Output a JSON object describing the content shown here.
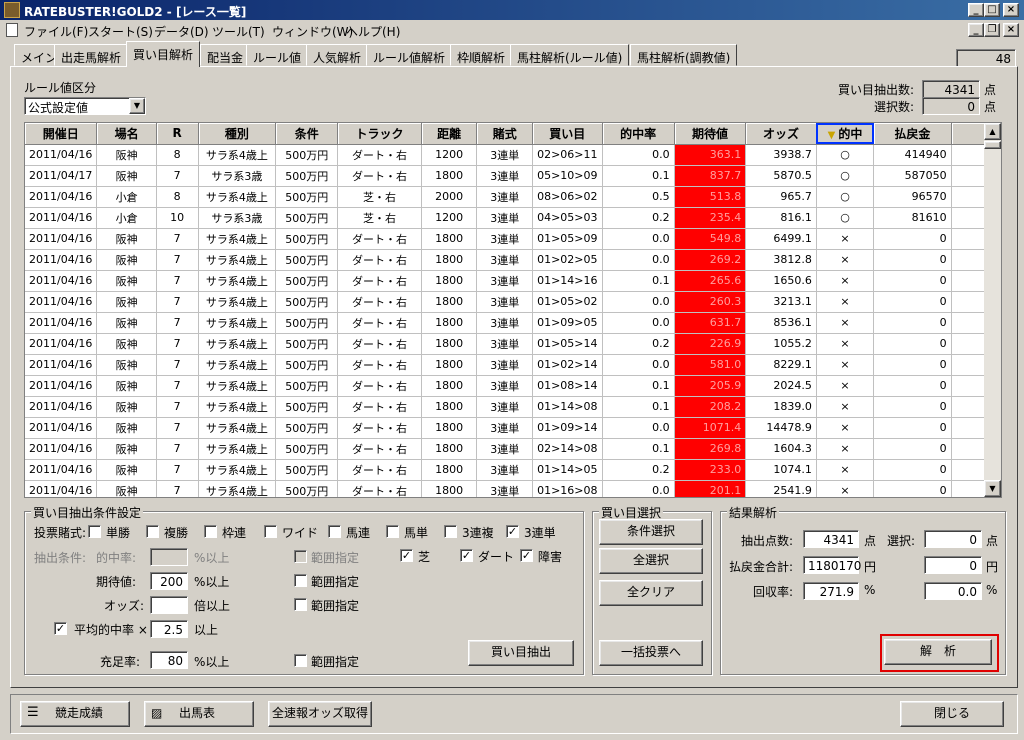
{
  "window": {
    "title": "RATEBUSTER!GOLD2 - [レース一覧]"
  },
  "menu": [
    "ファイル(F)",
    "スタート(S)",
    "データ(D)",
    "ツール(T)",
    "ウィンドウ(W)",
    "ヘルプ(H)"
  ],
  "tabs": [
    "メイン",
    "出走馬解析",
    "買い目解析",
    "配当金",
    "ルール値",
    "人気解析",
    "ルール値解析",
    "枠順解析",
    "馬柱解析(ルール値)",
    "馬柱解析(調教値)"
  ],
  "active_tab": 2,
  "tab_counter": "48",
  "rule": {
    "label": "ルール値区分",
    "selected": "公式設定値"
  },
  "summary": {
    "extract_label": "買い目抽出数:",
    "extract_value": "4341",
    "extract_unit": "点",
    "select_label": "選択数:",
    "select_value": "0",
    "select_unit": "点"
  },
  "table": {
    "columns": [
      "開催日",
      "場名",
      "R",
      "種別",
      "条件",
      "トラック",
      "距離",
      "賭式",
      "買い目",
      "的中率",
      "期待値",
      "オッズ",
      "的中",
      "払戻金"
    ],
    "rows": [
      [
        "2011/04/16",
        "阪神",
        "8",
        "サラ系4歳上",
        "500万円",
        "ダート・右",
        "1200",
        "3連単",
        "02>06>11",
        "0.0",
        "363.1",
        "3938.7",
        "○",
        "414940"
      ],
      [
        "2011/04/17",
        "阪神",
        "7",
        "サラ系3歳",
        "500万円",
        "ダート・右",
        "1800",
        "3連単",
        "05>10>09",
        "0.1",
        "837.7",
        "5870.5",
        "○",
        "587050"
      ],
      [
        "2011/04/16",
        "小倉",
        "8",
        "サラ系4歳上",
        "500万円",
        "芝・右",
        "2000",
        "3連単",
        "08>06>02",
        "0.5",
        "513.8",
        "965.7",
        "○",
        "96570"
      ],
      [
        "2011/04/16",
        "小倉",
        "10",
        "サラ系3歳",
        "500万円",
        "芝・右",
        "1200",
        "3連単",
        "04>05>03",
        "0.2",
        "235.4",
        "816.1",
        "○",
        "81610"
      ],
      [
        "2011/04/16",
        "阪神",
        "7",
        "サラ系4歳上",
        "500万円",
        "ダート・右",
        "1800",
        "3連単",
        "01>05>09",
        "0.0",
        "549.8",
        "6499.1",
        "×",
        "0"
      ],
      [
        "2011/04/16",
        "阪神",
        "7",
        "サラ系4歳上",
        "500万円",
        "ダート・右",
        "1800",
        "3連単",
        "01>02>05",
        "0.0",
        "269.2",
        "3812.8",
        "×",
        "0"
      ],
      [
        "2011/04/16",
        "阪神",
        "7",
        "サラ系4歳上",
        "500万円",
        "ダート・右",
        "1800",
        "3連単",
        "01>14>16",
        "0.1",
        "265.6",
        "1650.6",
        "×",
        "0"
      ],
      [
        "2011/04/16",
        "阪神",
        "7",
        "サラ系4歳上",
        "500万円",
        "ダート・右",
        "1800",
        "3連単",
        "01>05>02",
        "0.0",
        "260.3",
        "3213.1",
        "×",
        "0"
      ],
      [
        "2011/04/16",
        "阪神",
        "7",
        "サラ系4歳上",
        "500万円",
        "ダート・右",
        "1800",
        "3連単",
        "01>09>05",
        "0.0",
        "631.7",
        "8536.1",
        "×",
        "0"
      ],
      [
        "2011/04/16",
        "阪神",
        "7",
        "サラ系4歳上",
        "500万円",
        "ダート・右",
        "1800",
        "3連単",
        "01>05>14",
        "0.2",
        "226.9",
        "1055.2",
        "×",
        "0"
      ],
      [
        "2011/04/16",
        "阪神",
        "7",
        "サラ系4歳上",
        "500万円",
        "ダート・右",
        "1800",
        "3連単",
        "01>02>14",
        "0.0",
        "581.0",
        "8229.1",
        "×",
        "0"
      ],
      [
        "2011/04/16",
        "阪神",
        "7",
        "サラ系4歳上",
        "500万円",
        "ダート・右",
        "1800",
        "3連単",
        "01>08>14",
        "0.1",
        "205.9",
        "2024.5",
        "×",
        "0"
      ],
      [
        "2011/04/16",
        "阪神",
        "7",
        "サラ系4歳上",
        "500万円",
        "ダート・右",
        "1800",
        "3連単",
        "01>14>08",
        "0.1",
        "208.2",
        "1839.0",
        "×",
        "0"
      ],
      [
        "2011/04/16",
        "阪神",
        "7",
        "サラ系4歳上",
        "500万円",
        "ダート・右",
        "1800",
        "3連単",
        "01>09>14",
        "0.0",
        "1071.4",
        "14478.9",
        "×",
        "0"
      ],
      [
        "2011/04/16",
        "阪神",
        "7",
        "サラ系4歳上",
        "500万円",
        "ダート・右",
        "1800",
        "3連単",
        "02>14>08",
        "0.1",
        "269.8",
        "1604.3",
        "×",
        "0"
      ],
      [
        "2011/04/16",
        "阪神",
        "7",
        "サラ系4歳上",
        "500万円",
        "ダート・右",
        "1800",
        "3連単",
        "01>14>05",
        "0.2",
        "233.0",
        "1074.1",
        "×",
        "0"
      ],
      [
        "2011/04/16",
        "阪神",
        "7",
        "サラ系4歳上",
        "500万円",
        "ダート・右",
        "1800",
        "3連単",
        "01>16>08",
        "0.0",
        "201.1",
        "2541.9",
        "×",
        "0"
      ]
    ]
  },
  "extract": {
    "title": "買い目抽出条件設定",
    "bet_label": "投票賭式:",
    "bet_types": [
      {
        "label": "単勝",
        "checked": false
      },
      {
        "label": "複勝",
        "checked": false
      },
      {
        "label": "枠連",
        "checked": false
      },
      {
        "label": "ワイド",
        "checked": false
      },
      {
        "label": "馬連",
        "checked": false
      },
      {
        "label": "馬単",
        "checked": false
      },
      {
        "label": "3連複",
        "checked": false
      },
      {
        "label": "3連単",
        "checked": true
      }
    ],
    "cond_label": "抽出条件:",
    "hit_rate_label": "的中率:",
    "hit_rate_value": "",
    "hit_rate_unit": "%以上",
    "expect_label": "期待値:",
    "expect_value": "200",
    "expect_unit": "%以上",
    "odds_label": "オッズ:",
    "odds_value": "",
    "odds_unit": "倍以上",
    "range_label": "範囲指定",
    "tracks": [
      {
        "label": "芝",
        "checked": true
      },
      {
        "label": "ダート",
        "checked": true
      },
      {
        "label": "障害",
        "checked": true
      }
    ],
    "avg_label": "平均的中率 ×",
    "avg_value": "2.5",
    "avg_unit": "以上",
    "fill_label": "充足率:",
    "fill_value": "80",
    "fill_unit": "%以上",
    "button": "買い目抽出"
  },
  "select_group": {
    "title": "買い目選択",
    "buttons": [
      "条件選択",
      "全選択",
      "全クリア",
      "一括投票へ"
    ]
  },
  "result": {
    "title": "結果解析",
    "count_label": "抽出点数:",
    "count_value": "4341",
    "count_unit": "点",
    "sel_label": "選択:",
    "sel_value": "0",
    "sel_unit": "点",
    "payout_label": "払戻金合計:",
    "payout_value": "1180170",
    "payout_unit": "円",
    "payout_sel_value": "0",
    "payout_sel_unit": "円",
    "rate_label": "回収率:",
    "rate_value": "271.9",
    "rate_unit": "%",
    "rate_sel_value": "0.0",
    "rate_sel_unit": "%",
    "analyze_button": "解　析"
  },
  "statusbar": {
    "results_button": "競走成績",
    "card_button": "出馬表",
    "odds_button": "全速報オッズ取得",
    "close_button": "閉じる"
  },
  "colors": {
    "expect_cell": "#ff0000",
    "title_bar": "#0a246a",
    "hit_header_frame": "#0033ff",
    "analyze_frame": "#e00000"
  }
}
